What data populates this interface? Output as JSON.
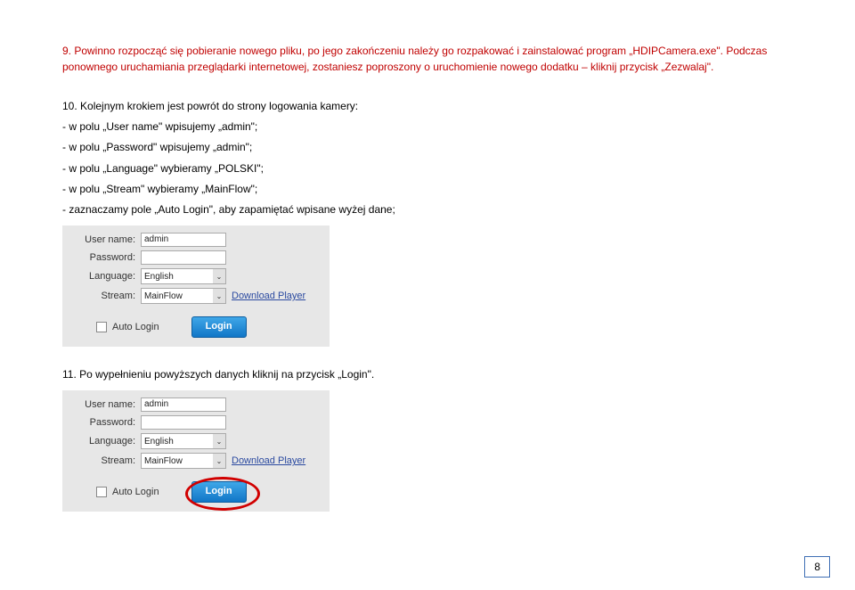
{
  "step9": "9. Powinno rozpocząć się pobieranie nowego pliku, po jego zakończeniu należy go rozpakować i zainstalować program „HDIPCamera.exe\". Podczas ponownego uruchamiania przeglądarki internetowej, zostaniesz poproszony o uruchomienie nowego dodatku – kliknij przycisk „Zezwalaj\".",
  "step10": {
    "header": "10. Kolejnym krokiem jest powrót do strony logowania kamery:",
    "lines": [
      "- w polu „User name\" wpisujemy „admin\";",
      "- w polu „Password\" wpisujemy „admin\";",
      "- w polu „Language\" wybieramy „POLSKI\";",
      "- w polu „Stream\" wybieramy „MainFlow\";",
      "- zaznaczamy pole „Auto Login\", aby zapamiętać wpisane wyżej dane;"
    ]
  },
  "login": {
    "labels": {
      "username": "User name:",
      "password": "Password:",
      "language": "Language:",
      "stream": "Stream:"
    },
    "values": {
      "username": "admin",
      "password": "",
      "language": "English",
      "stream": "MainFlow"
    },
    "download": "Download Player",
    "auto_login": "Auto Login",
    "button": "Login"
  },
  "step11": "11. Po wypełnieniu powyższych danych kliknij na przycisk „Login\".",
  "page_number": "8"
}
